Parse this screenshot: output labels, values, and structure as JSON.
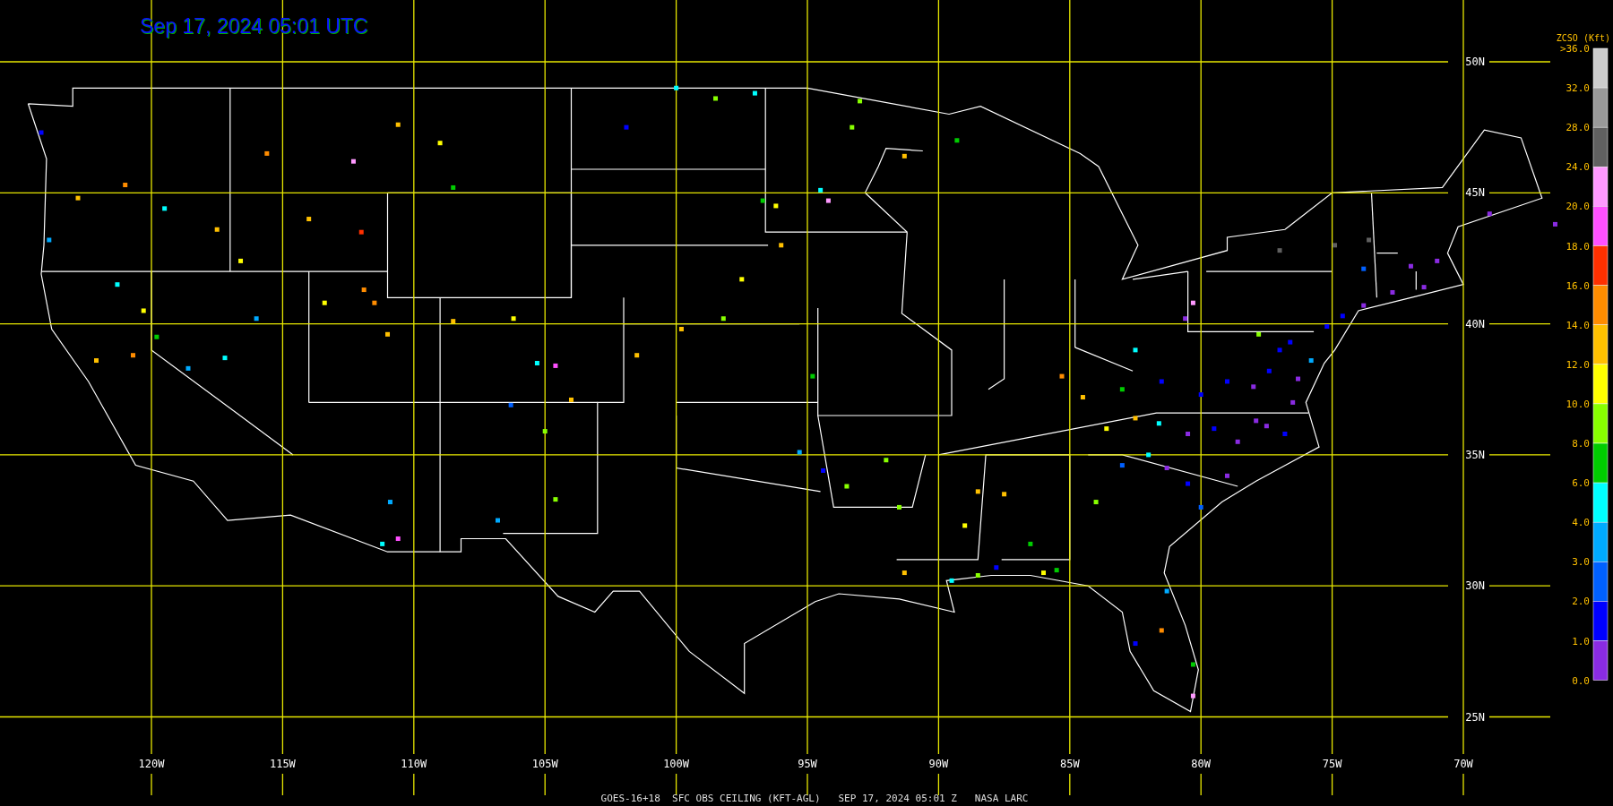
{
  "timestamp": "Sep 17, 2024 05:01 UTC",
  "lat_labels": [
    "50N",
    "45N",
    "40N",
    "35N",
    "30N",
    "25N"
  ],
  "lon_labels": [
    "120W",
    "115W",
    "110W",
    "105W",
    "100W",
    "95W",
    "90W",
    "85W",
    "80W",
    "75W",
    "70W"
  ],
  "legend": {
    "title": "ZCSO (Kft)",
    "labels": [
      ">36.0",
      "32.0",
      "28.0",
      "24.0",
      "20.0",
      "18.0",
      "16.0",
      "14.0",
      "12.0",
      "10.0",
      "8.0",
      "6.0",
      "4.0",
      "3.0",
      "2.0",
      "1.0",
      "0.0"
    ],
    "bins": [
      {
        "color": "#cccccc"
      },
      {
        "color": "#999999"
      },
      {
        "color": "#606060"
      },
      {
        "color": "#ff99ff"
      },
      {
        "color": "#ff50ff"
      },
      {
        "color": "#ff3000"
      },
      {
        "color": "#ff8c00"
      },
      {
        "color": "#ffc000"
      },
      {
        "color": "#ffff00"
      },
      {
        "color": "#88ff00"
      },
      {
        "color": "#00cc00"
      },
      {
        "color": "#00ffff"
      },
      {
        "color": "#00aaff"
      },
      {
        "color": "#0060ff"
      },
      {
        "color": "#0000ff"
      },
      {
        "color": "#8a2be2"
      }
    ]
  },
  "caption": "GOES-16+18  SFC OBS CEILING (KFT-AGL)   SEP 17, 2024 05:01 Z   NASA LARC"
}
